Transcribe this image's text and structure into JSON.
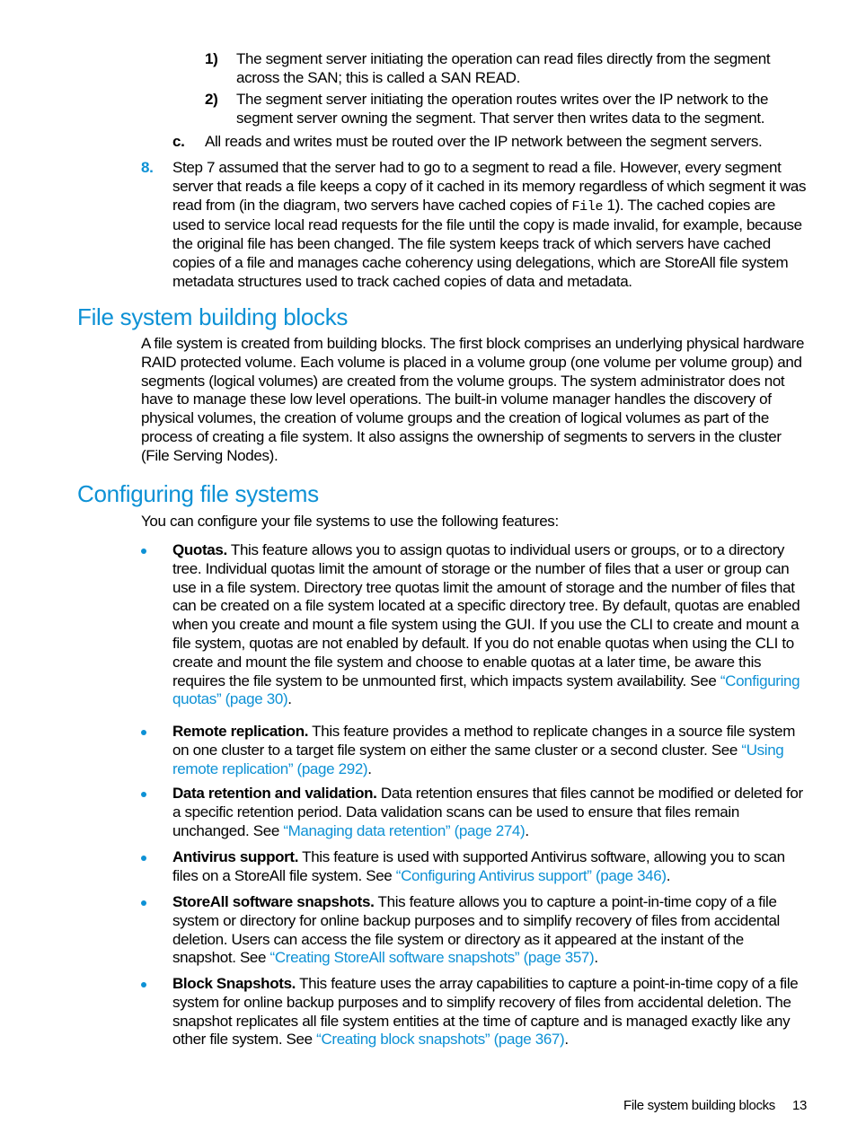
{
  "substeps": [
    {
      "marker": "1)",
      "text": "The segment server initiating the operation can read files directly from the segment across the SAN; this is called a SAN READ."
    },
    {
      "marker": "2)",
      "text": "The segment server initiating the operation routes writes over the IP network to the segment server owning the segment. That server then writes data to the segment."
    }
  ],
  "step_c": {
    "marker": "c.",
    "text": "All reads and writes must be routed over the IP network between the segment servers."
  },
  "step_8": {
    "marker": "8.",
    "text_before": "Step 7 assumed that the server had to go to a segment to read a file. However, every segment server that reads a file keeps a copy of it cached in its memory regardless of which segment it was read from (in the diagram, two servers have cached copies of ",
    "code": "File",
    "text_after": " 1). The cached copies are used to service local read requests for the file until the copy is made invalid, for example, because the original file has been changed. The file system keeps track of which servers have cached copies of a file and manages cache coherency using delegations, which are StoreAll file system metadata structures used to track cached copies of data and metadata."
  },
  "section_building_blocks": {
    "heading": "File system building blocks",
    "body": "A file system is created from building blocks. The first block comprises an underlying physical hardware RAID protected volume. Each volume is placed in a volume group (one volume per volume group) and segments (logical volumes) are created from the volume groups. The system administrator does not have to manage these low level operations. The built-in volume manager handles the discovery of physical volumes, the creation of volume groups and the creation of logical volumes as part of the process of creating a file system. It also assigns the ownership of segments to servers in the cluster (File Serving Nodes)."
  },
  "section_configuring": {
    "heading": "Configuring file systems",
    "intro": "You can configure your file systems to use the following features:",
    "features": [
      {
        "title": "Quotas.",
        "text": " This feature allows you to assign quotas to individual users or groups, or to a directory tree. Individual quotas limit the amount of storage or the number of files that a user or group can use in a file system. Directory tree quotas limit the amount of storage and the number of files that can be created on a file system located at a specific directory tree. By default, quotas are enabled when you create and mount a file system using the GUI. If you use the CLI to create and mount a file system, quotas are not enabled by default. If you do not enable quotas when using the CLI to create and mount the file system and choose to enable quotas at a later time, be aware this requires the file system to be unmounted first, which impacts system availability. See ",
        "link": "“Configuring quotas” (page 30)",
        "end": "."
      },
      {
        "title": "Remote replication.",
        "text": " This feature provides a method to replicate changes in a source file system on one cluster to a target file system on either the same cluster or a second cluster. See ",
        "link": "“Using remote replication” (page 292)",
        "end": "."
      },
      {
        "title": "Data retention and validation.",
        "text": " Data retention ensures that files cannot be modified or deleted for a specific retention period. Data validation scans can be used to ensure that files remain unchanged. See ",
        "link": "“Managing data retention” (page 274)",
        "end": "."
      },
      {
        "title": "Antivirus support.",
        "text": " This feature is used with supported Antivirus software, allowing you to scan files on a StoreAll file system. See ",
        "link": "“Configuring Antivirus support” (page 346)",
        "end": "."
      },
      {
        "title": "StoreAll software snapshots.",
        "text": " This feature allows you to capture a point-in-time copy of a file system or directory for online backup purposes and to simplify recovery of files from accidental deletion. Users can access the file system or directory as it appeared at the instant of the snapshot. See ",
        "link": "“Creating StoreAll software snapshots” (page 357)",
        "end": "."
      },
      {
        "title": "Block Snapshots.",
        "text": " This feature uses the array capabilities to capture a point-in-time copy of a file system for online backup purposes and to simplify recovery of files from accidental deletion. The snapshot replicates all file system entities at the time of capture and is managed exactly like any other file system. See ",
        "link": "“Creating block snapshots” (page 367)",
        "end": "."
      }
    ]
  },
  "footer": {
    "section": "File system building blocks",
    "page": "13"
  },
  "colors": {
    "accent": "#0d91d5",
    "text": "#000000"
  }
}
